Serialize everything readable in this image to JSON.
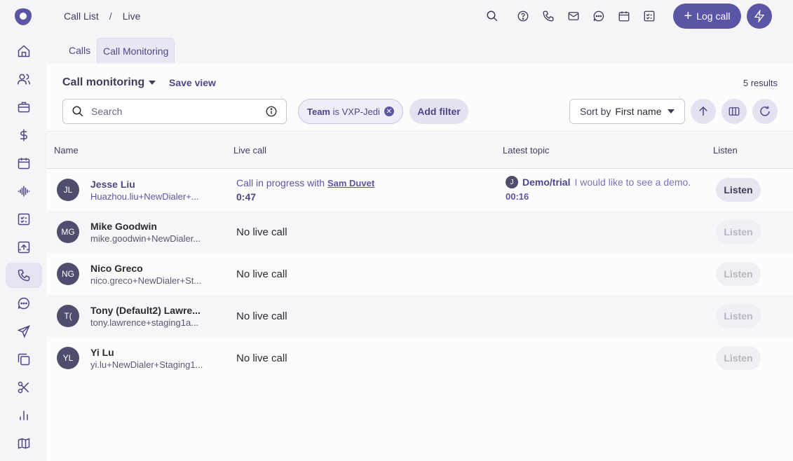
{
  "breadcrumb": {
    "root": "Call List",
    "sep": "/",
    "current": "Live"
  },
  "header": {
    "log_call": "Log call"
  },
  "tabs": [
    {
      "label": "Calls"
    },
    {
      "label": "Call Monitoring"
    }
  ],
  "toolbar": {
    "view_title": "Call monitoring",
    "save_view": "Save view",
    "results": "5 results",
    "search_placeholder": "Search",
    "filter_key": "Team",
    "filter_op": "is",
    "filter_value": "VXP-Jedi",
    "add_filter": "Add filter",
    "sort_label": "Sort by",
    "sort_value": "First name"
  },
  "table": {
    "headers": {
      "name": "Name",
      "live_call": "Live call",
      "latest_topic": "Latest topic",
      "listen": "Listen"
    },
    "rows": [
      {
        "initials": "JL",
        "name": "Jesse Liu",
        "email": "Huazhou.liu+NewDialer+...",
        "live_prefix": "Call in progress with",
        "live_with": "Sam Duvet",
        "duration": "0:47",
        "topic_initial": "J",
        "topic_name": "Demo/trial",
        "topic_text": "I would like to see a demo.",
        "topic_time": "00:16",
        "listen": "Listen"
      },
      {
        "initials": "MG",
        "name": "Mike Goodwin",
        "email": "mike.goodwin+NewDialer...",
        "live": "No live call",
        "listen": "Listen"
      },
      {
        "initials": "NG",
        "name": "Nico Greco",
        "email": "nico.greco+NewDialer+St...",
        "live": "No live call",
        "listen": "Listen"
      },
      {
        "initials": "T(",
        "name": "Tony (Default2) Lawre...",
        "email": "tony.lawrence+staging1a...",
        "live": "No live call",
        "listen": "Listen"
      },
      {
        "initials": "YL",
        "name": "Yi Lu",
        "email": "yi.lu+NewDialer+Staging1...",
        "live": "No live call",
        "listen": "Listen"
      }
    ]
  },
  "icons": {
    "sidebar": [
      "home-icon",
      "people-icon",
      "briefcase-icon",
      "dollar-icon",
      "calendar-icon",
      "waveform-icon",
      "checklist-icon",
      "upload-icon",
      "phone-icon",
      "chat-icon",
      "send-icon",
      "copy-icon",
      "scissors-icon",
      "bar-chart-icon",
      "map-icon"
    ],
    "header": [
      "search-icon",
      "help-icon",
      "phone-icon",
      "mail-icon",
      "chat-icon",
      "calendar-icon",
      "checklist-icon"
    ]
  },
  "colors": {
    "accent": "#5b55a6",
    "accent_light": "#e4e2f1",
    "text": "#2b2a33"
  }
}
